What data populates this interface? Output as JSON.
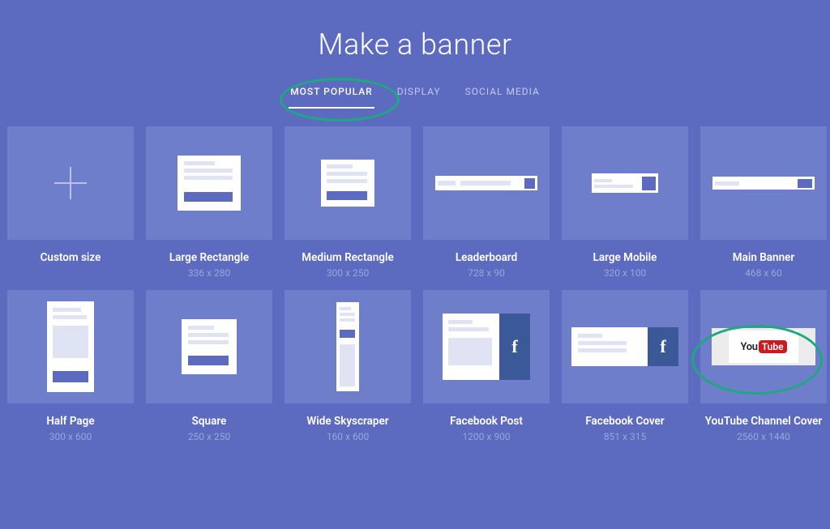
{
  "title": "Make a banner",
  "tabs": [
    {
      "label": "MOST POPULAR",
      "active": true
    },
    {
      "label": "DISPLAY",
      "active": false
    },
    {
      "label": "SOCIAL MEDIA",
      "active": false
    }
  ],
  "tiles": [
    {
      "id": "custom",
      "label": "Custom size",
      "dim": ""
    },
    {
      "id": "large-rect",
      "label": "Large Rectangle",
      "dim": "336 x 280"
    },
    {
      "id": "med-rect",
      "label": "Medium Rectangle",
      "dim": "300 x 250"
    },
    {
      "id": "leaderboard",
      "label": "Leaderboard",
      "dim": "728 x 90"
    },
    {
      "id": "large-mobile",
      "label": "Large Mobile",
      "dim": "320 x 100"
    },
    {
      "id": "main-banner",
      "label": "Main Banner",
      "dim": "468 x 60"
    },
    {
      "id": "half-page",
      "label": "Half Page",
      "dim": "300 x 600"
    },
    {
      "id": "square",
      "label": "Square",
      "dim": "250 x 250"
    },
    {
      "id": "skyscraper",
      "label": "Wide Skyscraper",
      "dim": "160 x 600"
    },
    {
      "id": "fb-post",
      "label": "Facebook Post",
      "dim": "1200 x 900"
    },
    {
      "id": "fb-cover",
      "label": "Facebook Cover",
      "dim": "851 x 315"
    },
    {
      "id": "yt-cover",
      "label": "YouTube Channel Cover",
      "dim": "2560 x 1440"
    }
  ],
  "youtube": {
    "you": "You",
    "tube": "Tube"
  },
  "colors": {
    "bg": "#5c6bc0",
    "tile": "#6f7ecb",
    "annot": "#1ca97d",
    "fb": "#3b5998",
    "yt": "#cc181e"
  }
}
